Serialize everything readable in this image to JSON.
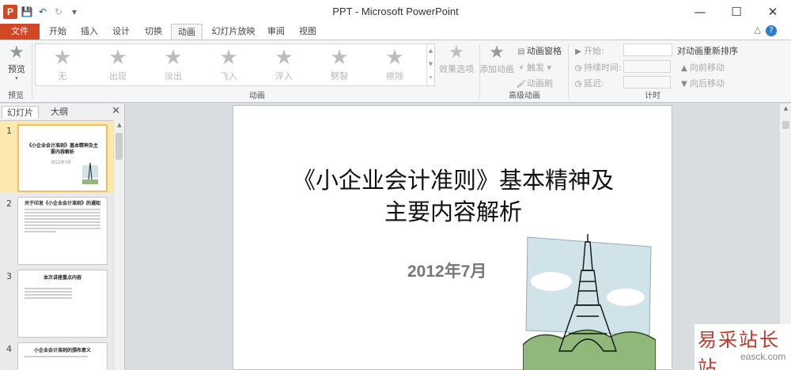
{
  "window": {
    "app_icon_letter": "P",
    "title": "PPT - Microsoft PowerPoint",
    "controls": [
      "minimize-icon",
      "maximize-icon",
      "close-icon"
    ]
  },
  "qat": {
    "icons": [
      "save-icon",
      "undo-icon",
      "redo-icon",
      "customize-icon"
    ]
  },
  "tabs": [
    {
      "label": "文件",
      "kind": "file"
    },
    {
      "label": "开始"
    },
    {
      "label": "插入"
    },
    {
      "label": "设计"
    },
    {
      "label": "切换"
    },
    {
      "label": "动画",
      "active": true
    },
    {
      "label": "幻灯片放映"
    },
    {
      "label": "审阅"
    },
    {
      "label": "视图"
    }
  ],
  "ribbon": {
    "preview": {
      "label": "预览",
      "group": "预览"
    },
    "animation_group": "动画",
    "effects": [
      "无",
      "出现",
      "淡出",
      "飞入",
      "浮入",
      "劈裂",
      "擦除"
    ],
    "effect_options": "效果选项",
    "add_animation": "添加动画",
    "advanced_group": "高级动画",
    "animation_pane": "动画窗格",
    "trigger": "触发",
    "painter": "动画刷",
    "timing_group": "计时",
    "start": "开始:",
    "duration": "持续时间:",
    "delay": "延迟:",
    "reorder": "对动画重新排序",
    "move_earlier": "向前移动",
    "move_later": "向后移动"
  },
  "panel": {
    "tabs": [
      "幻灯片",
      "大纲"
    ],
    "close": "✕",
    "slides": [
      {
        "num": "1",
        "title": "《小企业会计准则》基本精神及主要内容解析",
        "sub": "2012年7月"
      },
      {
        "num": "2",
        "title": "关于印发《小企业会计准则》的通知"
      },
      {
        "num": "3",
        "title": "本次讲座重点内容"
      },
      {
        "num": "4",
        "title": "小企业会计准则的颁布意义"
      }
    ]
  },
  "slide": {
    "title_line1": "《小企业会计准则》基本精神及",
    "title_line2": "主要内容解析",
    "date": "2012年7月"
  },
  "watermark": {
    "cn": "易采站长站",
    "en": "easck.com"
  },
  "colors": {
    "accent": "#d24726",
    "selection": "#f0c060"
  }
}
